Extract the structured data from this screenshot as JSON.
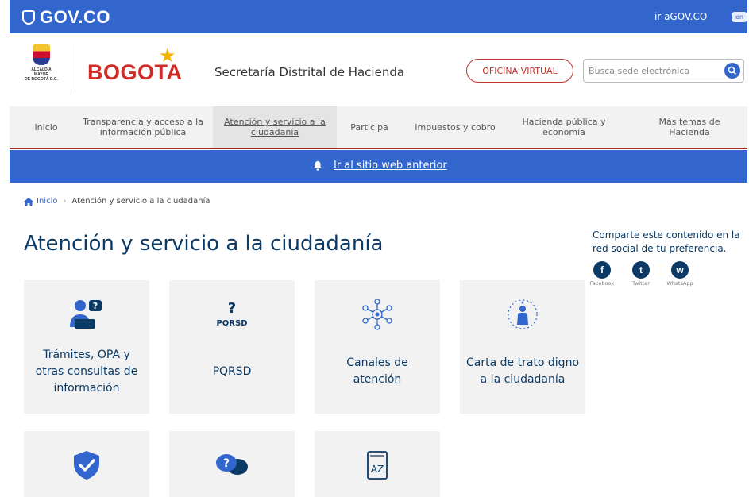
{
  "gov_bar": {
    "logo_text": "GOV.CO",
    "link_text": "ir aGOV.CO",
    "lang": "en"
  },
  "header": {
    "alcaldia_line1": "ALCALDÍA MAYOR",
    "alcaldia_line2": "DE BOGOTÁ D.C.",
    "bogota_logo": "BOGOTA",
    "secretaria": "Secretaría Distrital de Hacienda",
    "oficina_virtual": "OFICINA VIRTUAL",
    "search_placeholder": "Busca sede electrónica"
  },
  "nav": [
    {
      "label": "Inicio"
    },
    {
      "label": "Transparencia y acceso a la información pública"
    },
    {
      "label": "Atención y servicio a la ciudadanía",
      "active": true
    },
    {
      "label": "Participa"
    },
    {
      "label": "Impuestos y cobro"
    },
    {
      "label": "Hacienda pública y economía"
    },
    {
      "label": "Más temas de Hacienda"
    }
  ],
  "banner": {
    "link_text": "Ir al sitio web anterior"
  },
  "breadcrumb": {
    "home": "Inicio",
    "current": "Atención y servicio a la ciudadanía"
  },
  "page_title": "Atención y servicio a la ciudadanía",
  "share": {
    "text": "Comparte este contenido en la red social de tu preferencia.",
    "networks": [
      {
        "label": "Facebook",
        "glyph": "f",
        "icon": "facebook-icon"
      },
      {
        "label": "Twitter",
        "glyph": "t",
        "icon": "twitter-icon"
      },
      {
        "label": "WhatsApp",
        "glyph": "w",
        "icon": "whatsapp-icon"
      }
    ]
  },
  "cards": [
    {
      "label": "Trámites, OPA y otras consultas de información",
      "icon": "user-help-icon"
    },
    {
      "label": "PQRSD",
      "icon": "pqrsd-icon",
      "icon_text": "PQRSD"
    },
    {
      "label": "Canales de atención",
      "icon": "network-icon"
    },
    {
      "label": "Carta de trato digno a la ciudadanía",
      "icon": "person-stars-icon"
    },
    {
      "label": "",
      "icon": "shield-check-icon"
    },
    {
      "label": "",
      "icon": "chat-question-icon"
    },
    {
      "label": "",
      "icon": "dictionary-icon",
      "icon_text": "AZ"
    }
  ],
  "colors": {
    "primary": "#3366cc",
    "title": "#0b3a66",
    "accent_red": "#d12b27",
    "card_bg": "#f2f2f2"
  }
}
